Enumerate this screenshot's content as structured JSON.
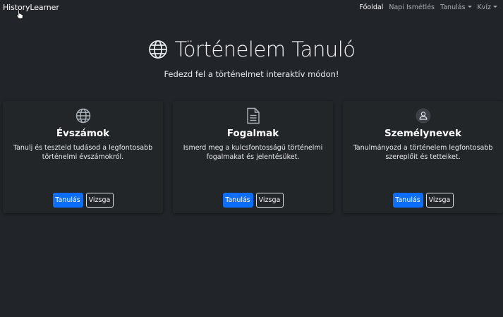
{
  "navbar": {
    "brand": "HistoryLearner",
    "links": [
      {
        "label": "Főoldal",
        "active": true,
        "dropdown": false
      },
      {
        "label": "Napi Ismétlés",
        "active": false,
        "dropdown": false
      },
      {
        "label": "Tanulás",
        "active": false,
        "dropdown": true
      },
      {
        "label": "Kvíz",
        "active": false,
        "dropdown": true
      }
    ]
  },
  "hero": {
    "title": "Történelem Tanuló",
    "subtitle": "Fedezd fel a történelmet interaktív módon!",
    "icon": "globe-icon"
  },
  "cards": [
    {
      "icon": "globe-icon",
      "title": "Évszámok",
      "text": "Tanulj és teszteld tudásod a legfontosabb történelmi évszámokról.",
      "primary": "Tanulás",
      "secondary": "Vizsga"
    },
    {
      "icon": "document-icon",
      "title": "Fogalmak",
      "text": "Ismerd meg a kulcsfontosságú történelmi fogalmakat és jelentésüket.",
      "primary": "Tanulás",
      "secondary": "Vizsga"
    },
    {
      "icon": "person-icon",
      "title": "Személynevek",
      "text": "Tanulmányozd a történelem legfontosabb szereplőit és tetteiket.",
      "primary": "Tanulás",
      "secondary": "Vizsga"
    }
  ],
  "colors": {
    "background": "#212529",
    "card": "#232629",
    "primary": "#0d6efd"
  }
}
